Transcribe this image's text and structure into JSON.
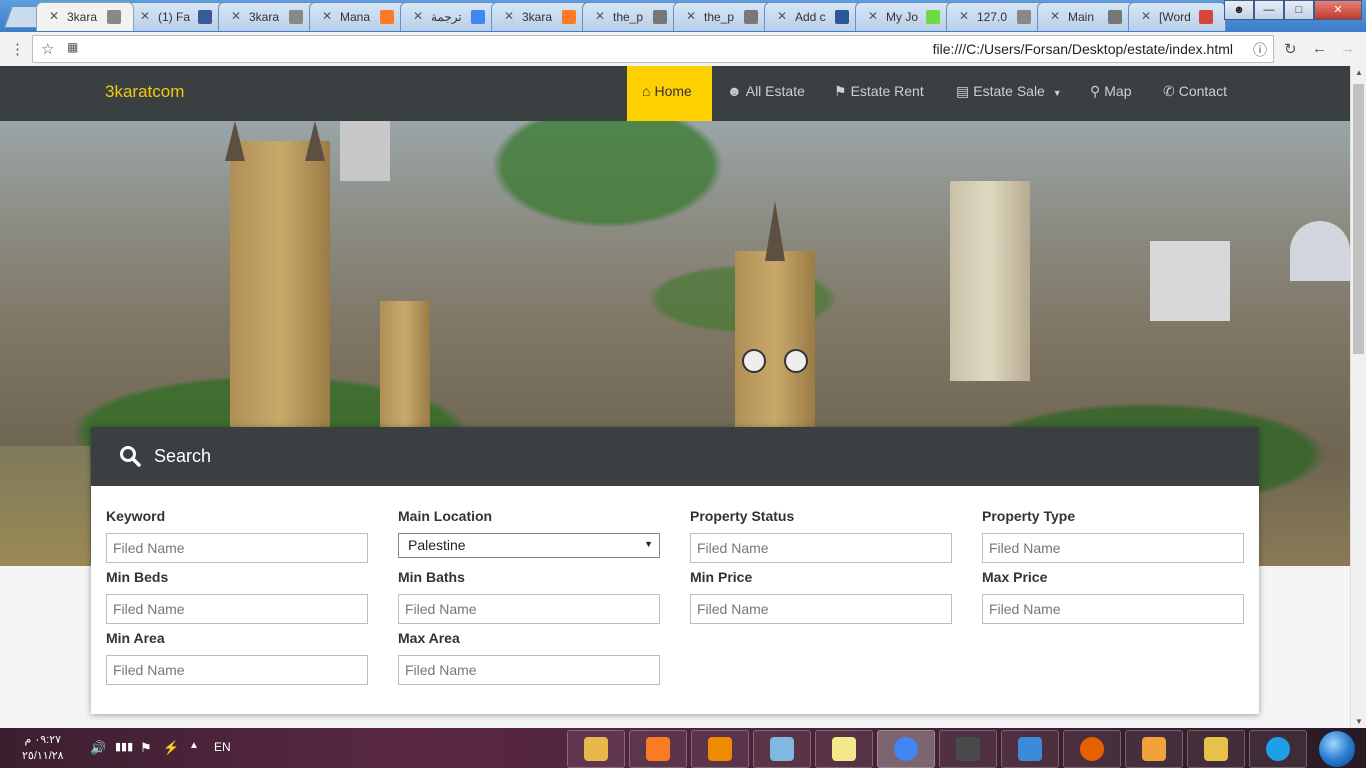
{
  "browser": {
    "tabs": [
      {
        "title": "3kara",
        "favicon": "page-icon",
        "color": "#888888"
      },
      {
        "title": "(1) Fa",
        "favicon": "facebook-icon",
        "color": "#3b5998"
      },
      {
        "title": "3kara",
        "favicon": "page-icon",
        "color": "#888888"
      },
      {
        "title": "Mana",
        "favicon": "xampp-icon",
        "color": "#fb7a24"
      },
      {
        "title": "ترجمة",
        "favicon": "google-translate-icon",
        "color": "#4285f4"
      },
      {
        "title": "3kara",
        "favicon": "xampp-icon",
        "color": "#fb7a24"
      },
      {
        "title": "the_p",
        "favicon": "wordpress-icon",
        "color": "#777777"
      },
      {
        "title": "the_p",
        "favicon": "wordpress-icon",
        "color": "#777777"
      },
      {
        "title": "Add c",
        "favicon": "word-icon",
        "color": "#2b579a"
      },
      {
        "title": "My Jo",
        "favicon": "upwork-icon",
        "color": "#6fda44"
      },
      {
        "title": "127.0",
        "favicon": "page-icon",
        "color": "#888888"
      },
      {
        "title": "Main",
        "favicon": "wordpress-icon",
        "color": "#777777"
      },
      {
        "title": "[Word",
        "favicon": "gmail-icon",
        "color": "#d44638"
      }
    ],
    "url": "file:///C:/Users/Forsan/Desktop/estate/index.html"
  },
  "site": {
    "brand": "3karatcom",
    "accent_color": "#ffd000",
    "nav": [
      {
        "label": "Home",
        "icon": "home-icon",
        "active": true
      },
      {
        "label": "All Estate",
        "icon": "user-icon",
        "active": false
      },
      {
        "label": "Estate Rent",
        "icon": "flag-icon",
        "active": false
      },
      {
        "label": "Estate Sale",
        "icon": "list-icon",
        "active": false,
        "dropdown": true
      },
      {
        "label": "Map",
        "icon": "map-marker-icon",
        "active": false
      },
      {
        "label": "Contact",
        "icon": "phone-icon",
        "active": false
      }
    ]
  },
  "search": {
    "title": "Search",
    "fields": {
      "keyword": {
        "label": "Keyword",
        "placeholder": "Filed Name"
      },
      "main_location": {
        "label": "Main Location",
        "value": "Palestine"
      },
      "property_status": {
        "label": "Property Status",
        "placeholder": "Filed Name"
      },
      "property_type": {
        "label": "Property Type",
        "placeholder": "Filed Name"
      },
      "min_beds": {
        "label": "Min Beds",
        "placeholder": "Filed Name"
      },
      "min_baths": {
        "label": "Min Baths",
        "placeholder": "Filed Name"
      },
      "min_price": {
        "label": "Min Price",
        "placeholder": "Filed Name"
      },
      "max_price": {
        "label": "Max Price",
        "placeholder": "Filed Name"
      },
      "min_area": {
        "label": "Min Area",
        "placeholder": "Filed Name"
      },
      "max_area": {
        "label": "Max Area",
        "placeholder": "Filed Name"
      }
    }
  },
  "taskbar": {
    "time": "٠٩:٢٧ م",
    "date": "٢٥/١١/٢٨",
    "language": "EN",
    "apps": [
      {
        "name": "explorer-icon",
        "color": "#e8b84a"
      },
      {
        "name": "xampp-icon",
        "color": "#fb7a24"
      },
      {
        "name": "vlc-icon",
        "color": "#f08a00"
      },
      {
        "name": "notepad-icon",
        "color": "#7fb8e0"
      },
      {
        "name": "sticky-notes-icon",
        "color": "#f3e98a"
      },
      {
        "name": "chrome-icon",
        "color": "#4285f4"
      },
      {
        "name": "sublime-text-icon",
        "color": "#4a4a4a"
      },
      {
        "name": "photo-viewer-icon",
        "color": "#3c8ad8"
      },
      {
        "name": "firefox-icon",
        "color": "#e66000"
      },
      {
        "name": "media-player-icon",
        "color": "#f2a23a"
      },
      {
        "name": "file-manager-icon",
        "color": "#e8c14a"
      },
      {
        "name": "internet-explorer-icon",
        "color": "#1ea0e8"
      }
    ]
  }
}
